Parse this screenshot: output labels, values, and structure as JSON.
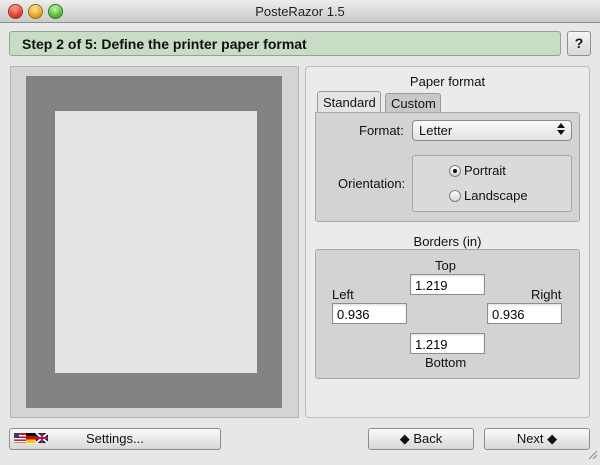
{
  "window": {
    "title": "PosteRazor 1.5"
  },
  "step": {
    "title": "Step 2 of 5: Define the printer paper format",
    "help_label": "?"
  },
  "paper_format": {
    "section_title": "Paper format",
    "tabs": [
      "Standard",
      "Custom"
    ],
    "active_tab": "Standard",
    "format_label": "Format:",
    "format_value": "Letter",
    "orientation_label": "Orientation:",
    "orientation_options": [
      "Portrait",
      "Landscape"
    ],
    "orientation_selected": "Portrait"
  },
  "borders": {
    "section_title": "Borders (in)",
    "top_label": "Top",
    "top_value": "1.219",
    "left_label": "Left",
    "left_value": "0.936",
    "right_label": "Right",
    "right_value": "0.936",
    "bottom_label": "Bottom",
    "bottom_value": "1.219"
  },
  "footer": {
    "settings_label": "Settings...",
    "back_label": "Back",
    "next_label": "Next"
  },
  "colors": {
    "banner": "#c8dcc6",
    "preview_paper": "#838383",
    "preview_printable": "#e4e4e4"
  }
}
